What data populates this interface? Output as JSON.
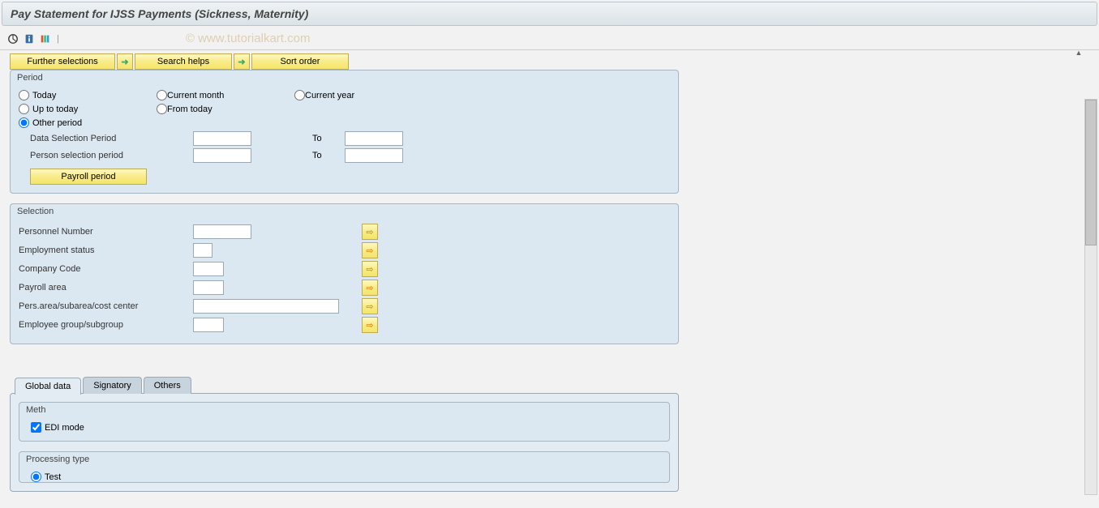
{
  "header": {
    "title": "Pay Statement for IJSS Payments (Sickness, Maternity)"
  },
  "watermark": "© www.tutorialkart.com",
  "toolbar_buttons": {
    "further": "Further selections",
    "search": "Search helps",
    "sort": "Sort order"
  },
  "period": {
    "title": "Period",
    "radios": {
      "today": "Today",
      "current_month": "Current month",
      "current_year": "Current year",
      "up_to_today": "Up to today",
      "from_today": "From today",
      "other_period": "Other period"
    },
    "data_sel": "Data Selection Period",
    "person_sel": "Person selection period",
    "to": "To",
    "payroll_btn": "Payroll period"
  },
  "selection": {
    "title": "Selection",
    "rows": [
      {
        "label": "Personnel Number",
        "w": "in-w1"
      },
      {
        "label": "Employment status",
        "w": "in-w3"
      },
      {
        "label": "Company Code",
        "w": "in-w4"
      },
      {
        "label": "Payroll area",
        "w": "in-w4"
      },
      {
        "label": "Pers.area/subarea/cost center",
        "w": "in-w5"
      },
      {
        "label": "Employee group/subgroup",
        "w": "in-w4"
      }
    ]
  },
  "tabs": {
    "global": "Global data",
    "signatory": "Signatory",
    "others": "Others"
  },
  "meth": {
    "title": "Meth",
    "edi": "EDI mode"
  },
  "processing": {
    "title": "Processing type",
    "test": "Test"
  }
}
